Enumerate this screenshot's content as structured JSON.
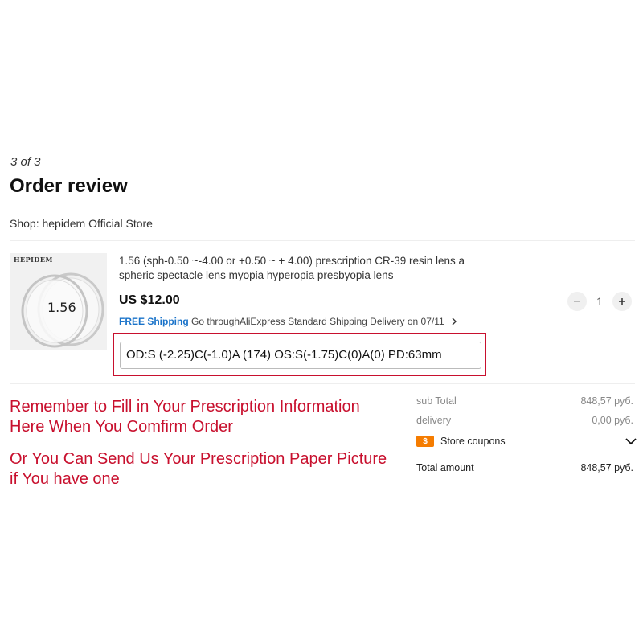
{
  "header": {
    "step": "3 of 3",
    "title": "Order review"
  },
  "shop": {
    "label": "Shop: hepidem Official Store"
  },
  "product": {
    "image_brand": "HEPIDEM",
    "image_label": "1.56",
    "title": "1.56 (sph-0.50 ~-4.00 or +0.50 ~ + 4.00) prescription CR-39 resin lens a spheric spectacle lens myopia hyperopia presbyopia lens",
    "price": "US $12.00",
    "quantity": "1",
    "minus_icon": "minus-icon",
    "plus_icon": "plus-icon",
    "shipping": {
      "free_label": "FREE Shipping",
      "method": "Go throughAliExpress Standard Shipping",
      "delivery": "Delivery on 07/11"
    },
    "prescription_value": "OD:S (-2.25)C(-1.0)A (174) OS:S(-1.75)C(0)A(0)  PD:63mm"
  },
  "notes": {
    "fill_in": "Remember to Fill in Your Prescription Information Here When You Comfirm Order",
    "send_picture": "Or You Can Send Us Your Prescription Paper Picture if You have one"
  },
  "summary": {
    "subtotal_label": "sub Total",
    "subtotal_value": "848,57 руб.",
    "delivery_label": "delivery",
    "delivery_value": "0,00 руб.",
    "coupon_badge": "$",
    "coupons_label": "Store coupons",
    "total_label": "Total amount",
    "total_value": "848,57 руб."
  },
  "colors": {
    "accent_red": "#c8102e",
    "free_shipping_blue": "#1a73c9",
    "coupon_orange": "#f57c00"
  }
}
